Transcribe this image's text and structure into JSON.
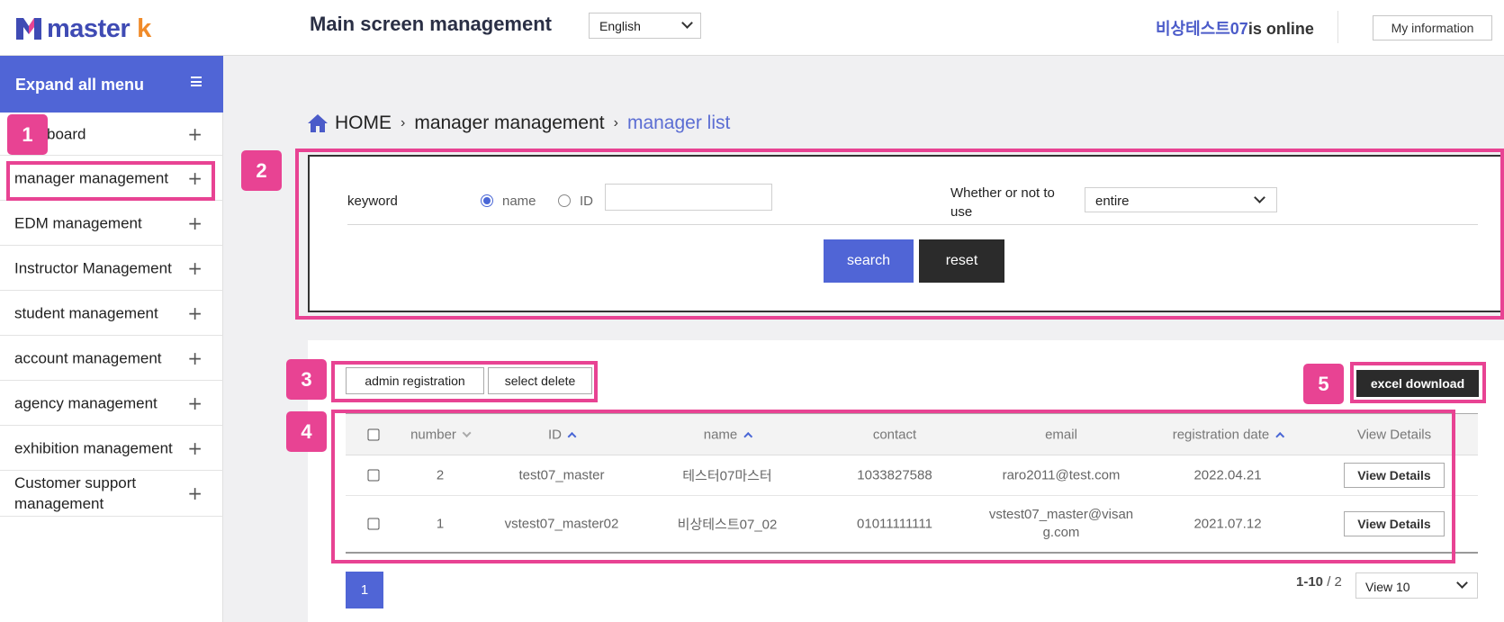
{
  "header": {
    "logo_text": "master",
    "logo_letter": "k",
    "page_title": "Main screen management",
    "language": "English",
    "online_user": "비상테스트07",
    "online_suffix": "is online",
    "my_info_label": "My information"
  },
  "sidebar": {
    "expand_label": "Expand all menu",
    "items": [
      {
        "label": "board"
      },
      {
        "label": "manager management"
      },
      {
        "label": "EDM management"
      },
      {
        "label": "Instructor Management"
      },
      {
        "label": "student management"
      },
      {
        "label": "account management"
      },
      {
        "label": "agency management"
      },
      {
        "label": "exhibition management"
      },
      {
        "label": "Customer support management"
      }
    ]
  },
  "breadcrumb": {
    "home": "HOME",
    "section": "manager management",
    "current": "manager list"
  },
  "search": {
    "keyword_label": "keyword",
    "radio_name": "name",
    "radio_id": "ID",
    "selected_radio": "name",
    "keyword_value": "",
    "use_label": "Whether or not to use",
    "use_value": "entire",
    "search_label": "search",
    "reset_label": "reset"
  },
  "actions": {
    "admin_registration": "admin registration",
    "select_delete": "select delete",
    "excel_download": "excel download"
  },
  "table": {
    "headers": {
      "number": "number",
      "id": "ID",
      "name": "name",
      "contact": "contact",
      "email": "email",
      "registration_date": "registration date",
      "view_details": "View Details"
    },
    "rows": [
      {
        "number": "2",
        "id": "test07_master",
        "name": "테스터07마스터",
        "contact": "1033827588",
        "email": "raro2011@test.com",
        "date": "2022.04.21",
        "details": "View Details"
      },
      {
        "number": "1",
        "id": "vstest07_master02",
        "name": "비상테스트07_02",
        "contact": "01011111111",
        "email": "vstest07_master@visang.com",
        "date": "2021.07.12",
        "details": "View Details"
      }
    ]
  },
  "pagination": {
    "current_page": "1",
    "range": "1-10",
    "total": "2",
    "view_count": "View 10"
  },
  "annotations": [
    "1",
    "2",
    "3",
    "4",
    "5"
  ],
  "colors": {
    "accent": "#5065d6",
    "annotation": "#e84393",
    "dark_button": "#2b2b2b"
  }
}
